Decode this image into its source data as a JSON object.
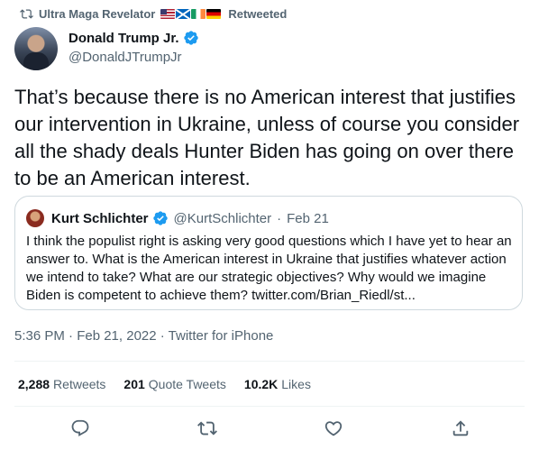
{
  "retweet_banner": {
    "user": "Ultra Maga Revelator",
    "flags": [
      "us-flag",
      "scotland-flag",
      "ireland-flag",
      "germany-flag"
    ],
    "suffix": "Retweeted"
  },
  "tweet": {
    "author_name": "Donald Trump Jr.",
    "author_handle": "@DonaldJTrumpJr",
    "text": "That’s because there is no American interest that justifies our intervention in Ukraine, unless of course you consider all the shady deals Hunter Biden has going on over there to be an American interest.",
    "timestamp": "5:36 PM · Feb 21, 2022 · Twitter for iPhone"
  },
  "quote": {
    "author_name": "Kurt Schlichter",
    "author_handle": "@KurtSchlichter",
    "separator": "·",
    "date": "Feb 21",
    "text": "I think the populist right is asking very good questions which I have yet to hear an answer to. What is the American interest in Ukraine that justifies whatever action we intend to take? What are our strategic objectives? Why would we imagine Biden is competent to achieve them? twitter.com/Brian_Riedl/st..."
  },
  "stats": {
    "retweets_count": "2,288",
    "retweets_label": "Retweets",
    "quotes_count": "201",
    "quotes_label": "Quote Tweets",
    "likes_count": "10.2K",
    "likes_label": "Likes"
  },
  "actions": [
    "reply-icon",
    "retweet-icon",
    "like-icon",
    "share-icon"
  ],
  "colors": {
    "text": "#0f1419",
    "secondary": "#536471",
    "verified": "#1d9bf0",
    "border": "#cfd9de",
    "divider": "#eff3f4"
  }
}
